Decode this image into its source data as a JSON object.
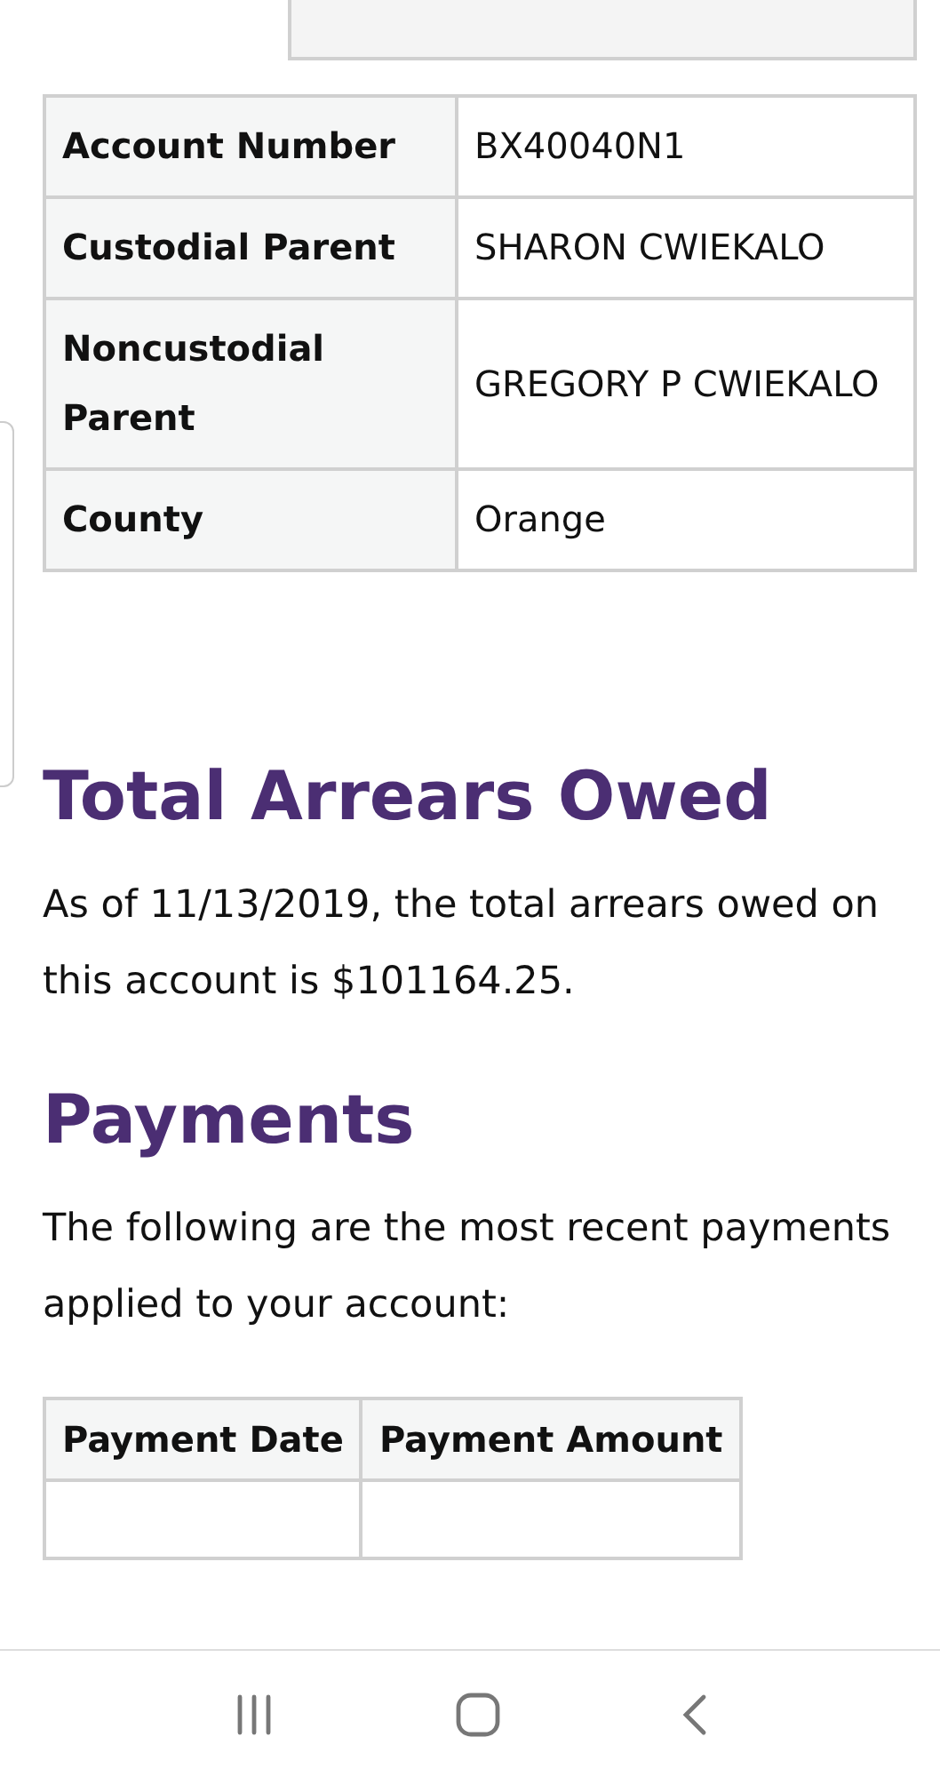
{
  "account_table": [
    {
      "label": "Account Number",
      "value": "BX40040N1"
    },
    {
      "label": "Custodial Parent",
      "value": "SHARON CWIEKALO"
    },
    {
      "label": "Noncustodial Parent",
      "value": "GREGORY P CWIEKALO"
    },
    {
      "label": "County",
      "value": "Orange"
    }
  ],
  "arrears": {
    "heading": "Total Arrears Owed",
    "text": "As of 11/13/2019, the total arrears owed on this account is $101164.25."
  },
  "payments": {
    "heading": "Payments",
    "text": "The following are the most recent payments applied to your account:",
    "columns": [
      "Payment Date",
      "Payment Amount"
    ]
  }
}
